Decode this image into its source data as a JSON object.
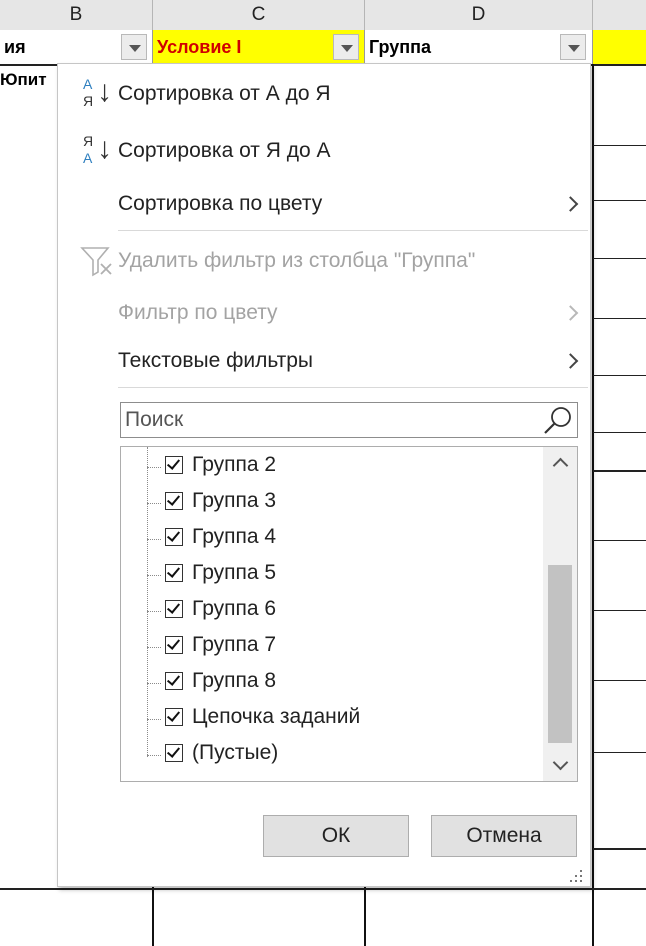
{
  "sheet": {
    "col_headers": [
      "B",
      "C",
      "D"
    ],
    "header_cells": {
      "b_partial": "ия",
      "c": "Условие I",
      "d": "Группа"
    },
    "row2_partial": "Юпит"
  },
  "menu": {
    "sort_az": {
      "label": "Сортировка от А до Я",
      "icon_top": "А",
      "icon_bottom": "Я"
    },
    "sort_za": {
      "label": "Сортировка от Я до А",
      "icon_top": "Я",
      "icon_bottom": "А"
    },
    "sort_color": {
      "label": "Сортировка по цвету"
    },
    "clear_filter": {
      "label": "Удалить фильтр из столбца \"Группа\""
    },
    "filter_color": {
      "label": "Фильтр по цвету"
    },
    "text_filters": {
      "label": "Текстовые фильтры"
    }
  },
  "search": {
    "placeholder": "Поиск"
  },
  "list": {
    "items": [
      {
        "label": "Группа 2",
        "checked": true
      },
      {
        "label": "Группа 3",
        "checked": true
      },
      {
        "label": "Группа 4",
        "checked": true
      },
      {
        "label": "Группа 5",
        "checked": true
      },
      {
        "label": "Группа 6",
        "checked": true
      },
      {
        "label": "Группа 7",
        "checked": true
      },
      {
        "label": "Группа 8",
        "checked": true
      },
      {
        "label": "Цепочка заданий",
        "checked": true
      },
      {
        "label": "(Пустые)",
        "checked": true
      }
    ]
  },
  "buttons": {
    "ok": "ОК",
    "cancel": "Отмена"
  },
  "colors": {
    "header_yellow": "#ffff00",
    "condition_red": "#d00000"
  }
}
